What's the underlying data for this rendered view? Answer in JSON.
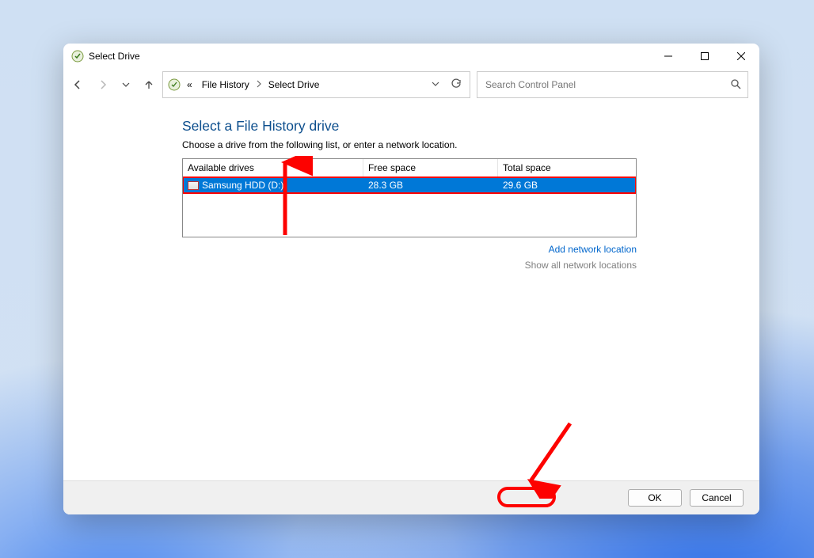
{
  "window": {
    "title": "Select Drive"
  },
  "addressbar": {
    "prefix": "«",
    "crumbs": [
      "File History",
      "Select Drive"
    ]
  },
  "search": {
    "placeholder": "Search Control Panel"
  },
  "page": {
    "heading": "Select a File History drive",
    "subtext": "Choose a drive from the following list, or enter a network location."
  },
  "table": {
    "headers": {
      "c1": "Available drives",
      "c2": "Free space",
      "c3": "Total space"
    },
    "rows": [
      {
        "name": "Samsung HDD (D:)",
        "free": "28.3 GB",
        "total": "29.6 GB",
        "selected": true
      }
    ]
  },
  "links": {
    "add": "Add network location",
    "showall": "Show all network locations"
  },
  "footer": {
    "ok": "OK",
    "cancel": "Cancel"
  }
}
